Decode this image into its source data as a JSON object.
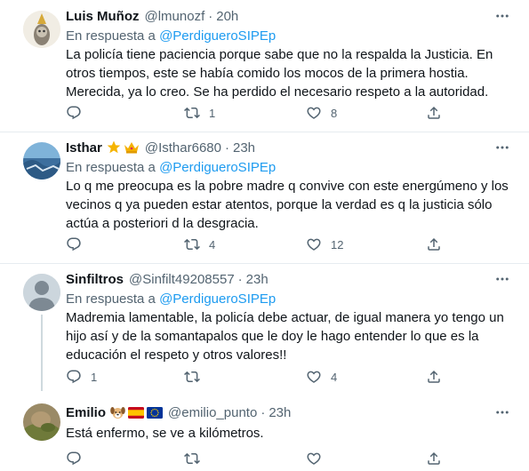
{
  "colors": {
    "link": "#1d9bf0",
    "muted": "#536471",
    "text": "#0f1419",
    "divider": "#e6ecf0"
  },
  "tweets": [
    {
      "name": "Luis Muñoz",
      "handle": "@lmunozf",
      "time": "20h",
      "reply_prefix": "En respuesta a",
      "reply_to": "@PerdigueroSIPEp",
      "text": "La policía tiene paciencia porque sabe que no la respalda la Justicia. En otros tiempos, este se había comido los mocos de la primera hostia. Merecida, ya lo creo. Se ha perdido el necesario respeto a la autoridad.",
      "replies": "",
      "retweets": "1",
      "likes": "8"
    },
    {
      "name": "Isthar",
      "emojis": [
        "star-emoji",
        "crown-emoji"
      ],
      "handle": "@Isthar6680",
      "time": "23h",
      "reply_prefix": "En respuesta a",
      "reply_to": "@PerdigueroSIPEp",
      "text": "Lo q me preocupa es la pobre madre q convive con este energúmeno y los vecinos q ya pueden estar atentos, porque la verdad es q la justicia sólo actúa a posteriori d la desgracia.",
      "replies": "",
      "retweets": "4",
      "likes": "12"
    },
    {
      "name": "Sinfiltros",
      "handle": "@Sinfilt49208557",
      "time": "23h",
      "reply_prefix": "En respuesta a",
      "reply_to": "@PerdigueroSIPEp",
      "text": "Madremia lamentable, la policía debe actuar, de igual manera yo tengo un hijo así y de la somantapalos que le doy le hago entender lo que es la educación el respeto y otros valores!!",
      "replies": "1",
      "retweets": "",
      "likes": "4"
    },
    {
      "name": "Emilio",
      "emojis": [
        "dog-emoji",
        "spain-flag-emoji",
        "eu-flag-emoji"
      ],
      "handle": "@emilio_punto",
      "time": "23h",
      "text": "Está enfermo, se ve a kilómetros.",
      "replies": "",
      "retweets": "",
      "likes": ""
    }
  ]
}
